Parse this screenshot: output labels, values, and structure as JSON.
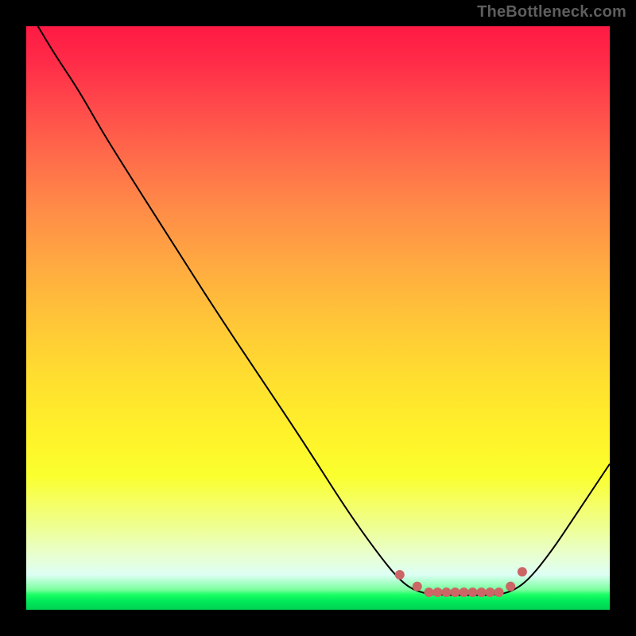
{
  "watermark": "TheBottleneck.com",
  "chart_data": {
    "type": "line",
    "title": "",
    "xlabel": "",
    "ylabel": "",
    "xlim": [
      0,
      100
    ],
    "ylim": [
      0,
      100
    ],
    "grid": false,
    "legend": false,
    "series": [
      {
        "name": "bottleneck-curve",
        "color": "#000000",
        "stroke_width": 2,
        "points": [
          {
            "x": 2,
            "y": 100
          },
          {
            "x": 5,
            "y": 95
          },
          {
            "x": 9,
            "y": 89
          },
          {
            "x": 13,
            "y": 82
          },
          {
            "x": 18,
            "y": 74
          },
          {
            "x": 25,
            "y": 63
          },
          {
            "x": 32,
            "y": 52
          },
          {
            "x": 40,
            "y": 40
          },
          {
            "x": 48,
            "y": 28
          },
          {
            "x": 55,
            "y": 17
          },
          {
            "x": 60,
            "y": 10
          },
          {
            "x": 64,
            "y": 5
          },
          {
            "x": 67,
            "y": 3
          },
          {
            "x": 71,
            "y": 2.5
          },
          {
            "x": 76,
            "y": 2.5
          },
          {
            "x": 80,
            "y": 2.5
          },
          {
            "x": 83,
            "y": 3
          },
          {
            "x": 86,
            "y": 5
          },
          {
            "x": 90,
            "y": 10
          },
          {
            "x": 94,
            "y": 16
          },
          {
            "x": 100,
            "y": 25
          }
        ]
      },
      {
        "name": "optimal-markers",
        "type": "scatter",
        "color": "#cc6666",
        "marker_radius": 6,
        "points": [
          {
            "x": 64,
            "y": 6
          },
          {
            "x": 67,
            "y": 4
          },
          {
            "x": 69,
            "y": 3
          },
          {
            "x": 70.5,
            "y": 3
          },
          {
            "x": 72,
            "y": 3
          },
          {
            "x": 73.5,
            "y": 3
          },
          {
            "x": 75,
            "y": 3
          },
          {
            "x": 76.5,
            "y": 3
          },
          {
            "x": 78,
            "y": 3
          },
          {
            "x": 79.5,
            "y": 3
          },
          {
            "x": 81,
            "y": 3
          },
          {
            "x": 83,
            "y": 4
          },
          {
            "x": 85,
            "y": 6.5
          }
        ]
      }
    ],
    "background_gradient": {
      "direction": "vertical",
      "stops": [
        {
          "pos": 0,
          "color": "#ff1a44"
        },
        {
          "pos": 50,
          "color": "#ffcf34"
        },
        {
          "pos": 80,
          "color": "#f6ff5c"
        },
        {
          "pos": 97,
          "color": "#1aff66"
        },
        {
          "pos": 100,
          "color": "#00d253"
        }
      ]
    }
  }
}
